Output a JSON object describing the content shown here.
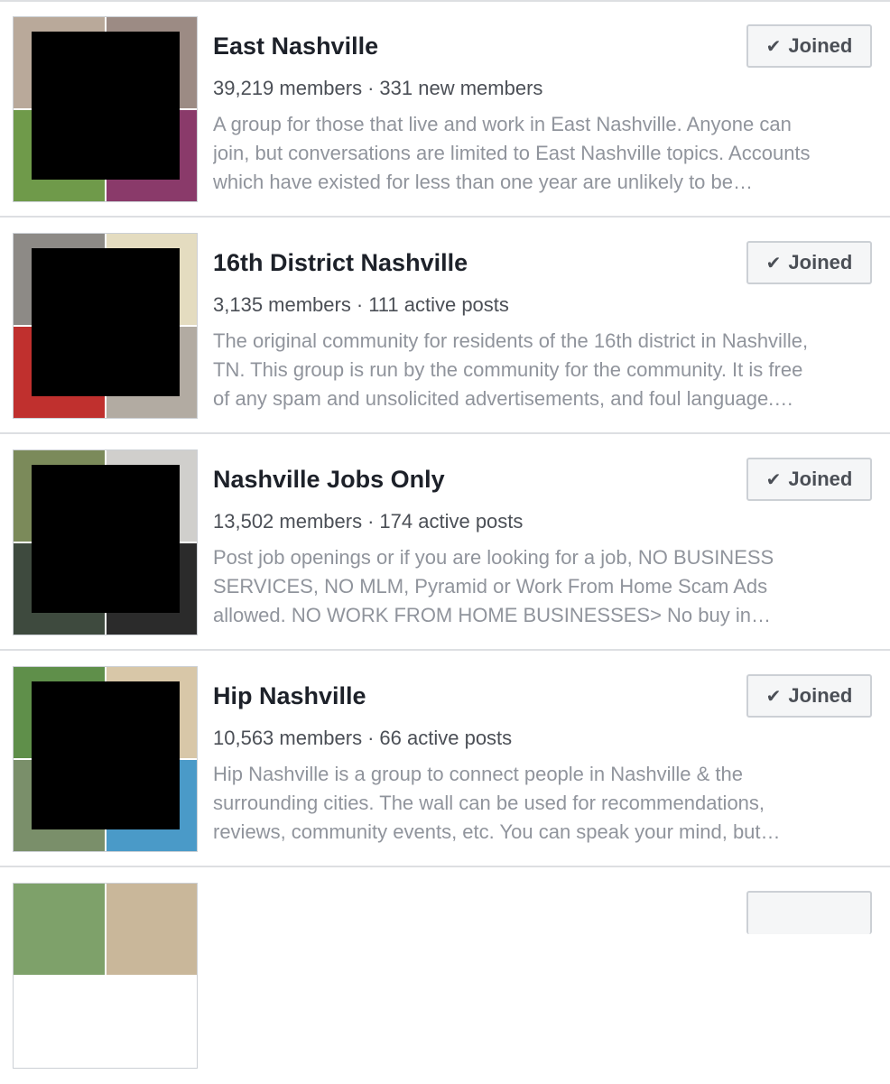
{
  "groups": [
    {
      "name": "East Nashville",
      "members": "39,219 members",
      "activity": "331 new members",
      "description_lines": [
        "A group for those that live and work in East Nashville. Anyone can",
        "join, but conversations are limited to East Nashville topics. Accounts",
        "which have existed for less than one year are unlikely to be…"
      ],
      "button_label": "Joined",
      "button_icon": "check-icon",
      "tiles": [
        "#b9a99a",
        "#9c8b84",
        "#6f9a4a",
        "#8a3a6a"
      ]
    },
    {
      "name": "16th District Nashville",
      "members": "3,135 members",
      "activity": "111 active posts",
      "description_lines": [
        "The original community for residents of the 16th district in Nashville,",
        "TN. This group is run by the community for the community. It is free",
        "of any spam and unsolicited advertisements, and foul language.…"
      ],
      "button_label": "Joined",
      "button_icon": "check-icon",
      "tiles": [
        "#8d8a86",
        "#e4dcc0",
        "#c0302e",
        "#b2aba2"
      ]
    },
    {
      "name": "Nashville Jobs Only",
      "members": "13,502 members",
      "activity": "174 active posts",
      "description_lines": [
        "Post job openings or if you are looking for a job, NO BUSINESS",
        "SERVICES, NO MLM, Pyramid or Work From Home Scam Ads",
        "allowed. NO WORK FROM HOME BUSINESSES> No buy in…"
      ],
      "button_label": "Joined",
      "button_icon": "check-icon",
      "tiles": [
        "#7b8a5a",
        "#d0cfcc",
        "#3e4a3e",
        "#2b2b2b"
      ]
    },
    {
      "name": "Hip Nashville",
      "members": "10,563 members",
      "activity": "66 active posts",
      "description_lines": [
        "Hip Nashville is a group to connect people in Nashville & the",
        "surrounding cities. The wall can be used for recommendations,",
        "reviews, community events, etc. You can speak your mind, but…"
      ],
      "button_label": "Joined",
      "button_icon": "check-icon",
      "tiles": [
        "#5f8f4a",
        "#d8c7a8",
        "#7a8f6a",
        "#4a9ac8"
      ]
    }
  ],
  "partial_next_group": {
    "tiles": [
      "#7ea16a",
      "#c9b79a"
    ]
  },
  "colors": {
    "title": "#1d2129",
    "meta": "#4b4f56",
    "description": "#90949c",
    "divider": "#dddfe2",
    "button_bg": "#f5f6f7",
    "button_border": "#ccd0d5"
  }
}
